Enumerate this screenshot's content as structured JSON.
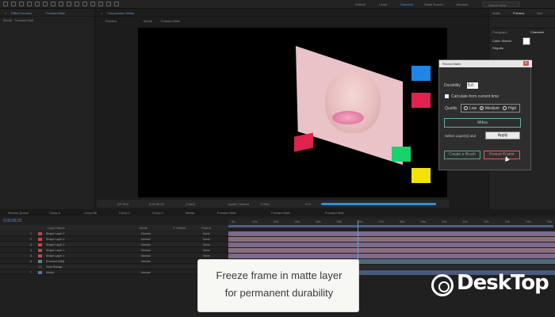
{
  "topbar": {
    "workspaces": [
      "Default",
      "Learn",
      "Standard",
      "Small Screen",
      "Libraries"
    ],
    "active_workspace": "Standard",
    "search_placeholder": "Search Help"
  },
  "left_panel": {
    "tab": "Effect Controls",
    "tab_suffix": "Forward Matt",
    "sub_label": "Media · Forward Matt"
  },
  "comp_panel": {
    "tab": "Composition Media",
    "subtabs": [
      "Preview",
      "Media",
      "Forward Matt"
    ]
  },
  "right_panel": {
    "tabs": [
      "Audio",
      "Preview",
      "Info"
    ],
    "character_tab": "Character",
    "paragraph_tab": "Paragraph",
    "font_name": "Cabin Sketch",
    "font_style": "Regular"
  },
  "dialog": {
    "title": "Reveal Matte",
    "durability_label": "Durability",
    "durability_value": "5.0",
    "calc_label": "Calculate from current time",
    "quality_label": "Quality",
    "quality_options": [
      "Low",
      "Medium",
      "High"
    ],
    "quality_selected": "Medium",
    "matte_button": "Mdea",
    "select_label": "Select Layer(s) and",
    "apply_button": "Apply",
    "brush_button": "Create a Brush",
    "freeze_button": "Freeze Frame"
  },
  "viewer_bar": {
    "zoom": "(37.9%)",
    "timecode": "0;00;05;02",
    "resolution": "(Third)",
    "camera": "Active Camera",
    "views": "1 View",
    "offset": "+0.0"
  },
  "timeline": {
    "tabs": [
      "Render Queue",
      "Comp 8",
      "Comp 8b",
      "Comp 1",
      "Comp 2",
      "Media",
      "Forward Matt",
      "Forward Matt",
      "Forward Matt"
    ],
    "active_tab": "Media",
    "timecode": "0;00;06;02",
    "columns": [
      "Layer Name",
      "Mode",
      "T TrkMat",
      "Parent"
    ],
    "layers": [
      {
        "num": "1",
        "name": "Shape Layer 2",
        "mode": "Normal",
        "parent": "None",
        "color": "#c0474a",
        "track": "#7f6a8f"
      },
      {
        "num": "2",
        "name": "Shape Layer 4",
        "mode": "Normal",
        "parent": "None",
        "color": "#c0474a",
        "track": "#8a6f7e"
      },
      {
        "num": "3",
        "name": "Shape Layer 3",
        "mode": "Normal",
        "parent": "None",
        "color": "#c0474a",
        "track": "#7d6a8d"
      },
      {
        "num": "4",
        "name": "Shape Layer 2",
        "mode": "Normal",
        "parent": "None",
        "color": "#c0474a",
        "track": "#8a6f7e"
      },
      {
        "num": "5",
        "name": "Shape Layer 1",
        "mode": "Normal",
        "parent": "None",
        "color": "#c0474a",
        "track": "#7d6a8d"
      },
      {
        "num": "6",
        "name": "[Forward Matt]",
        "mode": "Normal",
        "parent": "None",
        "color": "#5e8a8a",
        "track": "#4f6a7a"
      },
      {
        "num": "",
        "name": "Time Remap",
        "mode": "",
        "parent": "",
        "color": "#3a3a3a",
        "track": "#2b2b2b"
      },
      {
        "num": "7",
        "name": "Media",
        "mode": "Normal",
        "parent": "None",
        "color": "#5a72a8",
        "track": "#4a5a7c"
      }
    ],
    "ruler_ticks": [
      "0s",
      "01s",
      "02s",
      "03s",
      "04s",
      "05s",
      "06s",
      "07s",
      "08s",
      "09s",
      "10s",
      "11s",
      "12s",
      "13s",
      "14s",
      "15s"
    ]
  },
  "caption": {
    "line1": "Freeze frame in matte layer",
    "line2": "for permanent durability"
  },
  "watermark": {
    "text": "DeskTop"
  },
  "colors": {
    "accent": "#2d8ce0",
    "square_blue": "#1f86e6",
    "square_red": "#e0224f",
    "square_green": "#18d36b",
    "square_yellow": "#f3e20a"
  }
}
